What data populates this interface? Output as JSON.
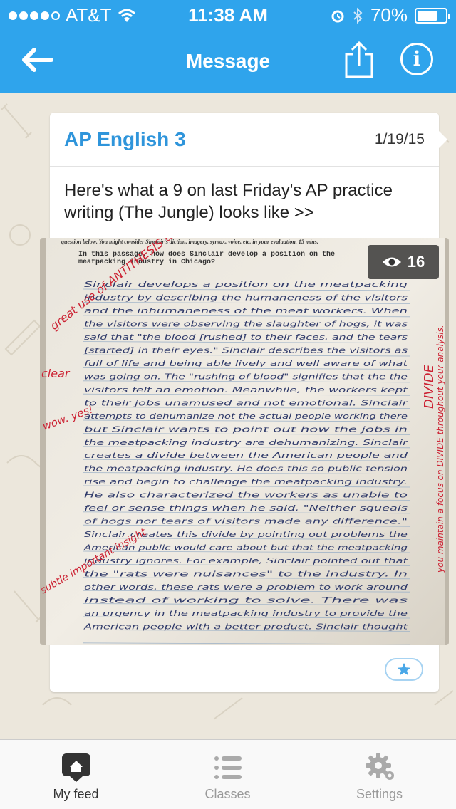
{
  "status_bar": {
    "carrier": "AT&T",
    "time": "11:38 AM",
    "battery": "70%",
    "battery_level": 0.7
  },
  "nav": {
    "title": "Message",
    "back_icon": "arrow-left-icon",
    "share_icon": "share-icon",
    "info_icon": "info-icon"
  },
  "message": {
    "group": "AP English 3",
    "date": "1/19/15",
    "text": "Here's what a 9 on last Friday's AP practice writing (The Jungle) looks like >>",
    "views": "16",
    "photo": {
      "header_line": "question below. You might consider Sinclair's diction, imagery, syntax, voice, etc. in your evaluation. 15 mins.",
      "prompt": "In this passage, how does Sinclair develop a position on the meatpacking industry in Chicago?",
      "handwriting": [
        "Sinclair develops a position on the meatpacking",
        "industry by describing the humaneness of the visitors",
        "and the inhumaneness of the meat workers. When",
        "the visitors were observing the slaughter of hogs, it was",
        "said that \"the blood [rushed] to their faces, and the tears",
        "[started] in their eyes.\" Sinclair describes the visitors as",
        "full of life and being able lively and well aware of what",
        "was going on. The \"rushing of blood\" signifies that the the",
        "visitors felt an emotion. Meanwhile, the workers kept",
        "to their jobs unamused and not emotional. Sinclair",
        "attempts to dehumanize not the actual people working there",
        "but Sinclair wants to point out how the jobs in",
        "the meatpacking industry are dehumanizing. Sinclair",
        "creates a divide between the American people and",
        "the meatpacking industry. He does this so public tension",
        "rise and begin to challenge the meatpacking industry.",
        "He also characterized the workers as unable to",
        "feel or sense things when he said, \"Neither squeals",
        "of hogs nor tears of visitors made any difference.\"",
        "Sinclair creates this divide by pointing out problems the",
        "American public would care about but that the meatpacking",
        "industry ignores. For example, Sinclair pointed out that",
        "the \"rats were nuisances\" to the industry. In",
        "other words, these rats were a problem to work around",
        "instead of working to solve. There was",
        "an urgency in the meatpacking industry to provide the",
        "American people with a better product. Sinclair thought"
      ],
      "annotations": {
        "top_left": "great use of ANTITHESIS to make your point",
        "clear": "clear",
        "wow": "wow. yes!",
        "subtle": "subtle important insight",
        "right_upper": "DIVIDE",
        "right_lower": "you maintain a focus on DIVIDE throughout your analysis."
      }
    },
    "star_icon": "star-icon"
  },
  "tabs": [
    {
      "label": "My feed",
      "icon": "home-icon",
      "active": true
    },
    {
      "label": "Classes",
      "icon": "list-icon",
      "active": false
    },
    {
      "label": "Settings",
      "icon": "gear-icon",
      "active": false
    }
  ],
  "colors": {
    "nav_blue": "#2fa4ec",
    "group_blue": "#2f95db",
    "background": "#ece7dc",
    "ink_red": "#cc2233"
  }
}
